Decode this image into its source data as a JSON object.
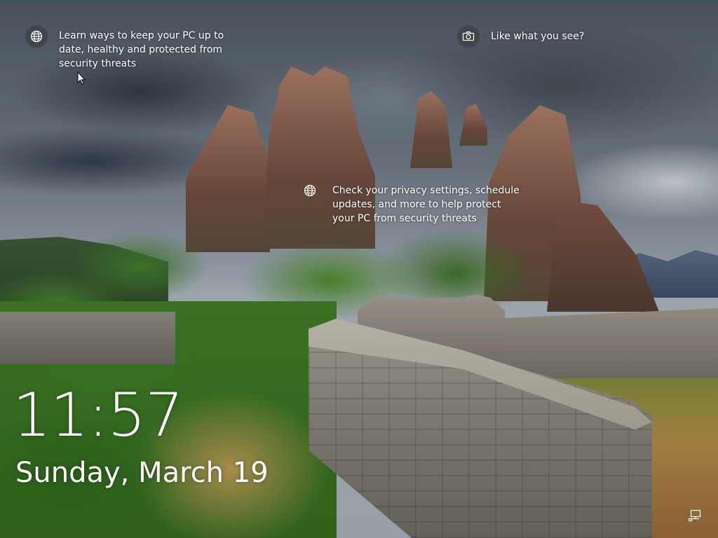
{
  "tips": [
    {
      "text": "Learn ways to keep your PC up to date, healthy and protected from security threats",
      "icon": "globe-icon"
    },
    {
      "text": "Like what you see?",
      "icon": "camera-icon"
    },
    {
      "text": "Check your privacy settings, schedule updates, and more to help protect your PC from security threats",
      "icon": "globe-icon"
    }
  ],
  "lock": {
    "time": "11:57",
    "date": "Sunday, March 19"
  },
  "status": {
    "network_icon": "network-icon"
  },
  "colors": {
    "text": "#ffffff",
    "icon_bg": "#3c4046"
  }
}
